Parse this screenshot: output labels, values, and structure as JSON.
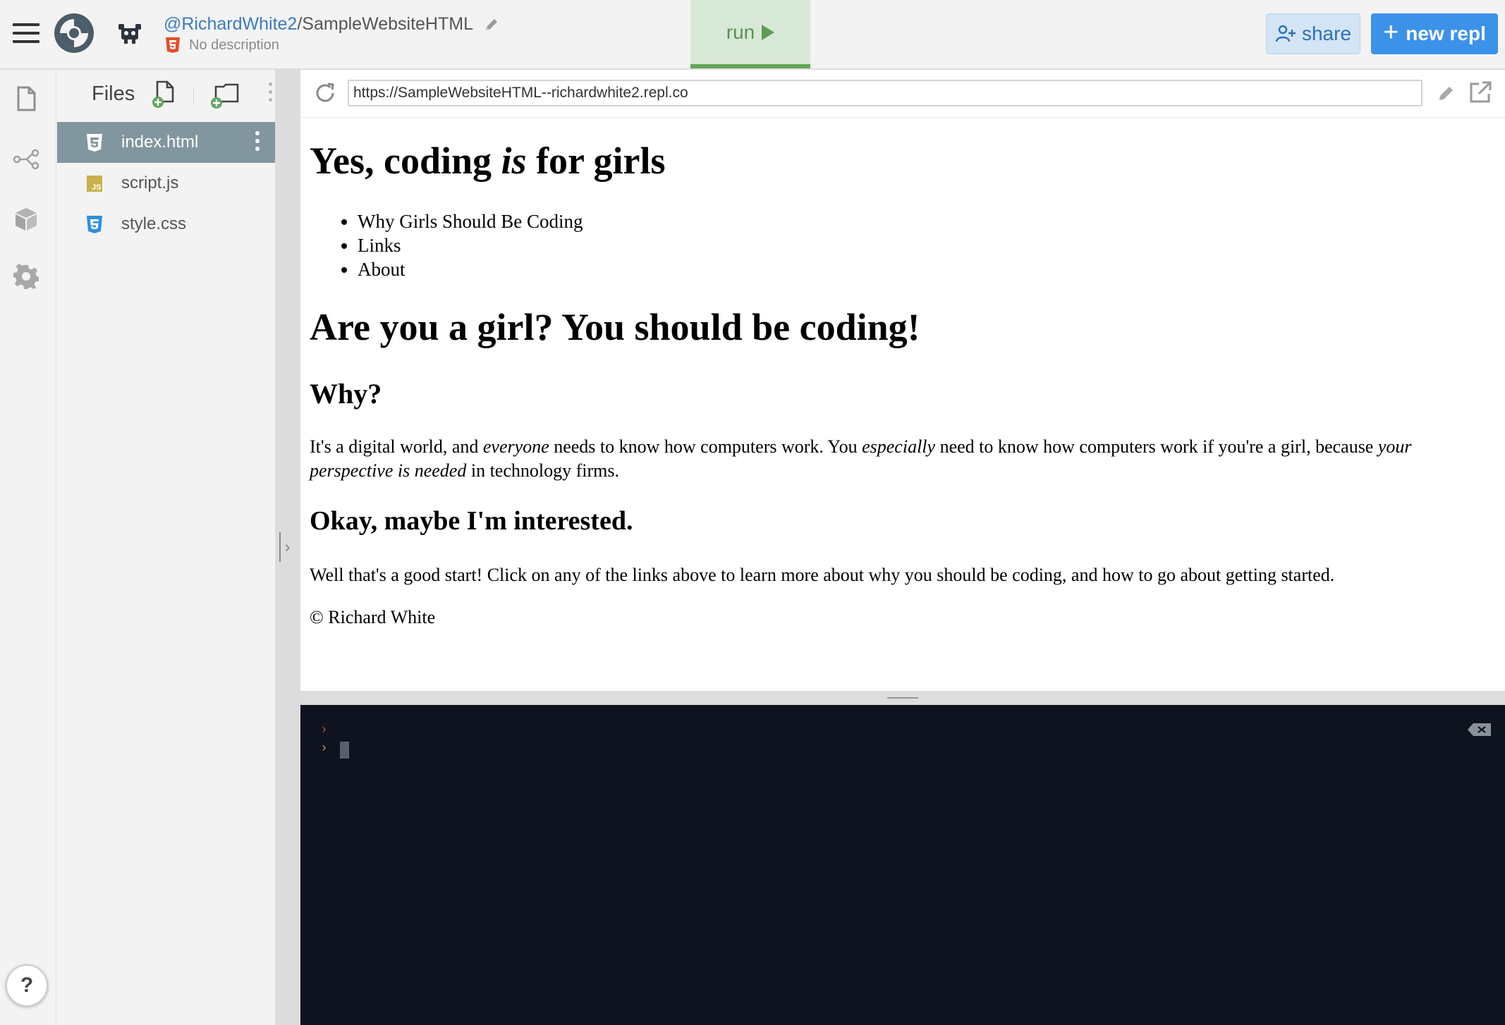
{
  "header": {
    "user": "@RichardWhite2",
    "separator": "/",
    "repl_name": "SampleWebsiteHTML",
    "description": "No description",
    "run_label": "run",
    "share_label": "share",
    "new_repl_label": "new repl",
    "new_repl_plus": "+"
  },
  "files": {
    "title": "Files",
    "items": [
      {
        "name": "index.html",
        "type": "html",
        "active": true
      },
      {
        "name": "script.js",
        "type": "js",
        "active": false
      },
      {
        "name": "style.css",
        "type": "css",
        "active": false
      }
    ]
  },
  "help_label": "?",
  "browser": {
    "url": "https://SampleWebsiteHTML--richardwhite2.repl.co"
  },
  "page": {
    "h1_pre": "Yes, coding ",
    "h1_em": "is",
    "h1_post": " for girls",
    "nav": [
      "Why Girls Should Be Coding",
      "Links",
      "About"
    ],
    "h2": "Are you a girl? You should be coding!",
    "why_heading": "Why?",
    "why_p1": "It's a digital world, and ",
    "why_em1": "everyone",
    "why_p2": " needs to know how computers work. You ",
    "why_em2": "especially",
    "why_p3": " need to know how computers work if you're a girl, because ",
    "why_em3": "your perspective is needed",
    "why_p4": " in technology firms.",
    "interested_heading": "Okay, maybe I'm interested.",
    "interested_p": "Well that's a good start! Click on any of the links above to learn more about why you should be coding, and how to go about getting started.",
    "copyright": "© Richard White"
  },
  "console": {
    "prompt_char": "›"
  },
  "colors": {
    "accent_blue": "#3c92e9",
    "run_green": "#62a558",
    "active_file": "#81969f",
    "console_bg": "#0f1320"
  }
}
